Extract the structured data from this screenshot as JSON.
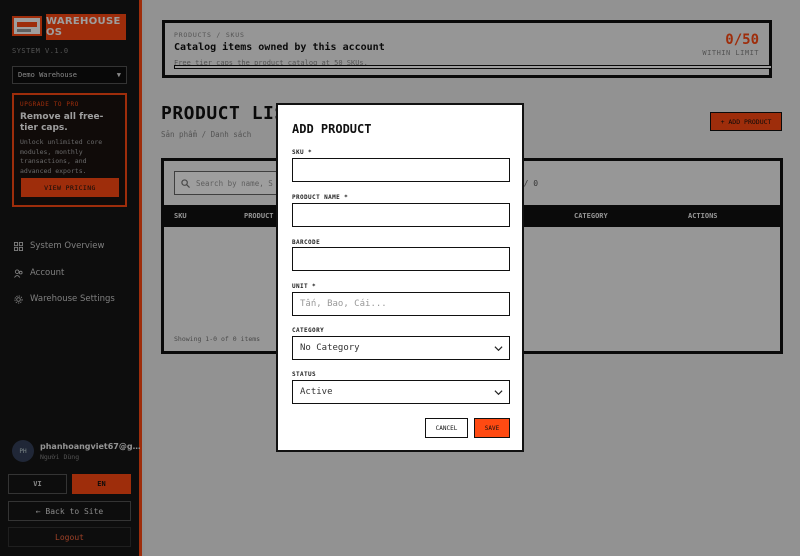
{
  "sidebar": {
    "brand": "WAREHOUSE OS",
    "system_version": "SYSTEM V.1.0",
    "warehouse_select": "Demo Warehouse",
    "upgrade": {
      "label": "UPGRADE TO PRO",
      "title": "Remove all free-tier caps.",
      "description": "Unlock unlimited core modules, monthly transactions, and advanced exports.",
      "button": "VIEW PRICING"
    },
    "nav": [
      {
        "label": "System Overview",
        "icon": "grid-icon"
      },
      {
        "label": "Account",
        "icon": "users-icon"
      },
      {
        "label": "Warehouse Settings",
        "icon": "gear-icon"
      }
    ],
    "user": {
      "initials": "PH",
      "name": "phanhoangviet67@g…",
      "role": "Người Dùng"
    },
    "lang": {
      "vi": "VI",
      "en": "EN"
    },
    "back_label": "← Back to Site",
    "logout_label": "Logout"
  },
  "limit_card": {
    "breadcrumb": "PRODUCTS / SKUS",
    "title": "Catalog items owned by this account",
    "subtitle": "Free tier caps the product catalog at 50 SKUs.",
    "count": "0/50",
    "status": "WITHIN LIMIT",
    "usage_fraction": 0
  },
  "page": {
    "title": "PRODUCT LIS",
    "subtitle": "Sản phẩm / Danh sách",
    "add_button": "+ ADD PRODUCT"
  },
  "table": {
    "search_placeholder": "Search by name, S",
    "pager": "0 / 0",
    "columns": [
      "SKU",
      "PRODUCT",
      "CATEGORY",
      "ACTIONS"
    ],
    "showing": "Showing 1-0 of 0 items"
  },
  "modal": {
    "title": "ADD PRODUCT",
    "fields": {
      "sku": {
        "label": "SKU *",
        "value": ""
      },
      "name": {
        "label": "PRODUCT NAME *",
        "value": ""
      },
      "barcode": {
        "label": "BARCODE",
        "value": ""
      },
      "unit": {
        "label": "UNIT *",
        "placeholder": "Tấn, Bao, Cái..."
      },
      "category": {
        "label": "CATEGORY",
        "value": "No Category"
      },
      "status": {
        "label": "STATUS",
        "value": "Active"
      }
    },
    "cancel": "CANCEL",
    "save": "SAVE"
  },
  "colors": {
    "accent": "#ff4a12",
    "sidebar_bg": "#151515",
    "ink": "#111111"
  }
}
